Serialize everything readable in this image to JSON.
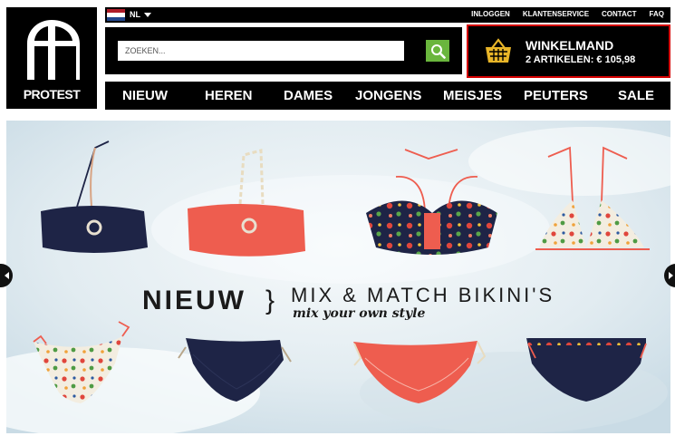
{
  "brand": {
    "name": "PROTEST",
    "logo_icon": "protest-logo"
  },
  "topbar": {
    "language": "NL",
    "flag_icon": "netherlands-flag",
    "links": [
      "INLOGGEN",
      "KLANTENSERVICE",
      "CONTACT",
      "FAQ"
    ]
  },
  "search": {
    "placeholder": "ZOEKEN...",
    "value": "",
    "button_icon": "search-icon",
    "button_color": "#6ab63d"
  },
  "cart": {
    "title": "WINKELMAND",
    "summary": "2 ARTIKELEN: € 105,98",
    "icon": "basket-icon",
    "icon_color": "#e8b528",
    "highlight_color": "#d40000"
  },
  "nav": {
    "items": [
      "NIEUW",
      "HEREN",
      "DAMES",
      "JONGENS",
      "MEISJES",
      "PEUTERS",
      "SALE"
    ]
  },
  "banner": {
    "headline": "NIEUW",
    "separator": "}",
    "title": "MIX & MATCH BIKINI'S",
    "subtitle": "mix your own style",
    "prev_icon": "chevron-left-icon",
    "next_icon": "chevron-right-icon",
    "tops": [
      "navy bandeau top",
      "coral bandeau top",
      "navy floral bandeau top",
      "white floral triangle top"
    ],
    "bottoms": [
      "white floral bottom",
      "navy bottom",
      "coral bottom",
      "navy floral-trim bottom"
    ],
    "colors": {
      "navy": "#1e2446",
      "coral": "#ee5d4f",
      "floral_white": "#f3ede0",
      "background": "#e4edf2"
    }
  }
}
